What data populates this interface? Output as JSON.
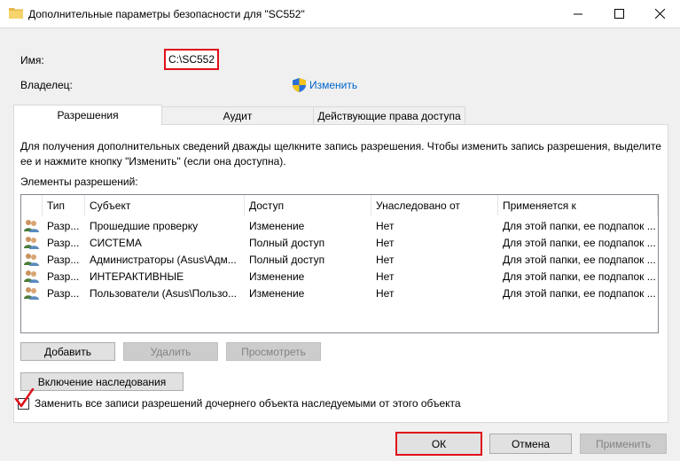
{
  "window": {
    "title": "Дополнительные параметры безопасности  для \"SC552\""
  },
  "owner_section": {
    "name_label": "Имя:",
    "name_value": "C:\\SC552",
    "owner_label": "Владелец:",
    "change_link": "Изменить"
  },
  "tabs": [
    {
      "label": "Разрешения",
      "active": true
    },
    {
      "label": "Аудит",
      "active": false
    },
    {
      "label": "Действующие права доступа",
      "active": false
    }
  ],
  "permissions": {
    "description": "Для получения дополнительных сведений дважды щелкните запись разрешения. Чтобы изменить запись разрешения, выделите ее и нажмите кнопку \"Изменить\" (если она доступна).",
    "list_caption": "Элементы разрешений:",
    "columns": [
      "Тип",
      "Субъект",
      "Доступ",
      "Унаследовано от",
      "Применяется к"
    ],
    "rows": [
      {
        "type": "Разр...",
        "subject": "Прошедшие проверку",
        "access": "Изменение",
        "inherited": "Нет",
        "applies": "Для этой папки, ее подпапок ..."
      },
      {
        "type": "Разр...",
        "subject": "СИСТЕМА",
        "access": "Полный доступ",
        "inherited": "Нет",
        "applies": "Для этой папки, ее подпапок ..."
      },
      {
        "type": "Разр...",
        "subject": "Администраторы (Asus\\Адм...",
        "access": "Полный доступ",
        "inherited": "Нет",
        "applies": "Для этой папки, ее подпапок ..."
      },
      {
        "type": "Разр...",
        "subject": "ИНТЕРАКТИВНЫЕ",
        "access": "Изменение",
        "inherited": "Нет",
        "applies": "Для этой папки, ее подпапок ..."
      },
      {
        "type": "Разр...",
        "subject": "Пользователи (Asus\\Пользо...",
        "access": "Изменение",
        "inherited": "Нет",
        "applies": "Для этой папки, ее подпапок ..."
      }
    ],
    "add_button": "Добавить",
    "remove_button": "Удалить",
    "view_button": "Просмотреть",
    "inherit_button": "Включение наследования",
    "replace_checkbox": {
      "label": "Заменить все записи разрешений дочернего объекта наследуемыми от этого объекта",
      "checked": true
    }
  },
  "footer": {
    "ok": "ОК",
    "cancel": "Отмена",
    "apply": "Применить"
  },
  "colors": {
    "highlight_red": "#e0101a",
    "link_blue": "#0066cc"
  }
}
